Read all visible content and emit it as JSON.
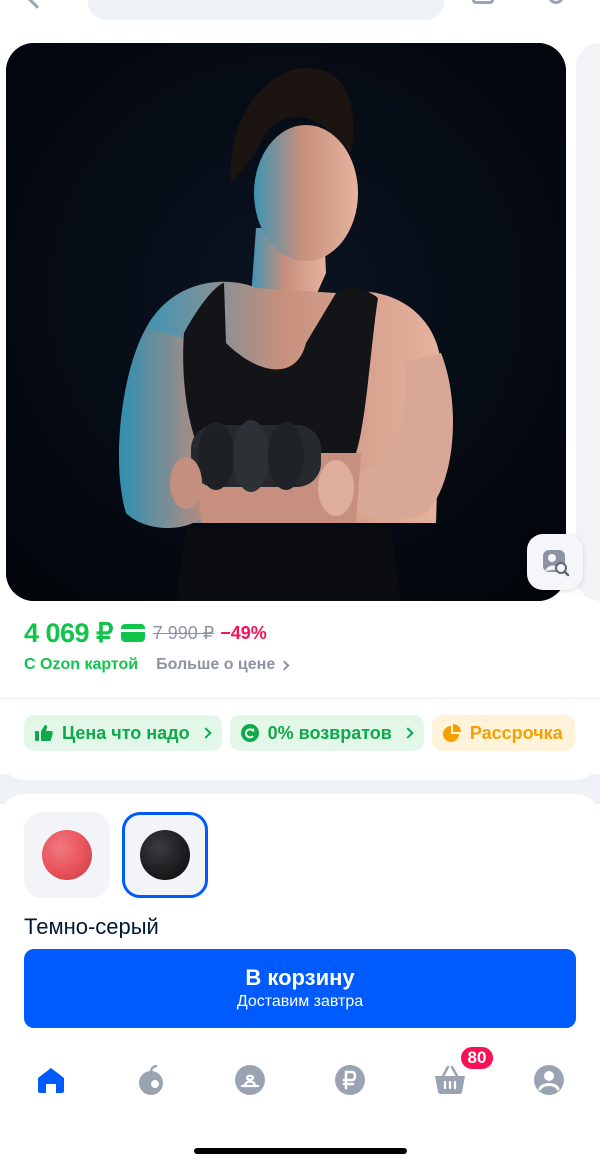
{
  "product": {
    "price": "4 069 ₽",
    "old_price": "7 990 ₽",
    "discount": "−49%",
    "ozon_card_label": "С Ozon картой",
    "price_more_label": "Больше о цене"
  },
  "chips": [
    {
      "label": "Цена что надо",
      "icon": "thumb-up-icon"
    },
    {
      "label": "0% возвратов",
      "icon": "return-icon"
    },
    {
      "label": "Рассрочка",
      "icon": "pie-icon"
    }
  ],
  "variants": {
    "items": [
      {
        "color": "#e8525a"
      },
      {
        "color": "#1b1b1d"
      }
    ],
    "selected_name": "Темно-серый"
  },
  "cart_button": {
    "label": "В корзину",
    "sublabel": "Доставим завтра"
  },
  "tabbar": {
    "items": [
      "home-icon",
      "fresh-icon",
      "catalog-icon",
      "finance-icon",
      "cart-icon",
      "profile-icon"
    ],
    "cart_badge": "80"
  },
  "colors": {
    "accent": "#005bff",
    "price_green": "#10c44c",
    "discount_red": "#f91155"
  }
}
